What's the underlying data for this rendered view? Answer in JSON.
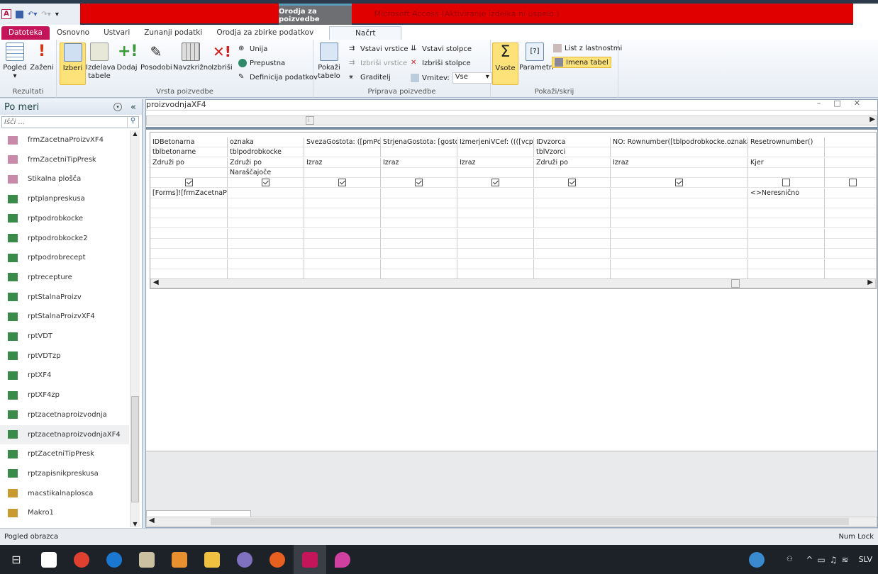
{
  "app": {
    "title": "Microsoft Access (Aktiviranje izdelka ni uspelo.)",
    "context_tab": "Orodja za poizvedbe",
    "accent": "#c4145a"
  },
  "tabs": [
    "Datoteka",
    "Osnovno",
    "Ustvari",
    "Zunanji podatki",
    "Orodja za zbirke podatkov",
    "Načrt"
  ],
  "ribbon": {
    "rezultati": {
      "label": "Rezultati",
      "pogled": "Pogled",
      "zazeni": "Zaženi"
    },
    "vrsta": {
      "label": "Vrsta poizvedbe",
      "izberi": "Izberi",
      "izdelava": "Izdelava tabele",
      "dodaj": "Dodaj",
      "posodobi": "Posodobi",
      "navzkrizno": "Navzkrižno",
      "izbrisi": "Izbriši",
      "unija": "Unija",
      "prepustna": "Prepustna",
      "definicija": "Definicija podatkov"
    },
    "priprava": {
      "label": "Priprava poizvedbe",
      "pokazi": "Pokaži tabelo",
      "vstavi_vrstice": "Vstavi vrstice",
      "izbrisi_vrstice": "Izbriši vrstice",
      "graditelj": "Graditelj",
      "vstavi_stolpce": "Vstavi stolpce",
      "izbrisi_stolpce": "Izbriši stolpce",
      "vrnitev": "Vrnitev:",
      "vrnitev_value": "Vse"
    },
    "pokazi_skrij": {
      "label": "Pokaži/skrij",
      "vsote": "Vsote",
      "parametri": "Parametri",
      "list": "List z lastnostmi",
      "imena": "Imena tabel"
    }
  },
  "nav": {
    "title": "Po meri",
    "search_placeholder": "Išči ...",
    "items": [
      {
        "label": "frmZacetnaProizvXF4",
        "type": "form"
      },
      {
        "label": "frmZacetniTipPresk",
        "type": "form"
      },
      {
        "label": "Stikalna plošča",
        "type": "form"
      },
      {
        "label": "rptplanpreskusa",
        "type": "report"
      },
      {
        "label": "rptpodrobkocke",
        "type": "report"
      },
      {
        "label": "rptpodrobkocke2",
        "type": "report"
      },
      {
        "label": "rptpodrobrecept",
        "type": "report"
      },
      {
        "label": "rptrecepture",
        "type": "report"
      },
      {
        "label": "rptStalnaProizv",
        "type": "report"
      },
      {
        "label": "rptStalnaProizvXF4",
        "type": "report"
      },
      {
        "label": "rptVDT",
        "type": "report"
      },
      {
        "label": "rptVDTzp",
        "type": "report"
      },
      {
        "label": "rptXF4",
        "type": "report"
      },
      {
        "label": "rptXF4zp",
        "type": "report"
      },
      {
        "label": "rptzacetnaproizvodnja",
        "type": "report"
      },
      {
        "label": "rptzacetnaproizvodnjaXF4",
        "type": "report",
        "selected": true
      },
      {
        "label": "rptZacetniTipPresk",
        "type": "report"
      },
      {
        "label": "rptzapisnikpreskusa",
        "type": "report"
      },
      {
        "label": "macstikalnaplosca",
        "type": "macro"
      },
      {
        "label": "Makro1",
        "type": "macro"
      }
    ]
  },
  "query": {
    "title": "proizvodnjaXF4",
    "columns": [
      {
        "field": "IDBetonarna",
        "table": "tblbetonarne",
        "total": "Združi po",
        "sort": "",
        "show": true,
        "criteria": "[Forms]![frmZacetnaProi"
      },
      {
        "field": "oznaka",
        "table": "tblpodrobkocke",
        "total": "Združi po",
        "sort": "Naraščajoče",
        "show": true,
        "criteria": ""
      },
      {
        "field": "SvezaGostota: ([pmPoln",
        "table": "",
        "total": "Izraz",
        "sort": "",
        "show": true,
        "criteria": ""
      },
      {
        "field": "StrjenaGostota: [gostota",
        "table": "",
        "total": "Izraz",
        "sort": "",
        "show": true,
        "criteria": ""
      },
      {
        "field": "IzmerjeniVCef: ((([vcpoln",
        "table": "",
        "total": "Izraz",
        "sort": "",
        "show": true,
        "criteria": ""
      },
      {
        "field": "IDvzorca",
        "table": "tblVzorci",
        "total": "Združi po",
        "sort": "",
        "show": true,
        "criteria": ""
      },
      {
        "field": "NO: Rownumber([tblpodrobkocke.oznaka])",
        "table": "",
        "total": "Izraz",
        "sort": "",
        "show": true,
        "criteria": ""
      },
      {
        "field": "Resetrownumber()",
        "table": "",
        "total": "Kjer",
        "sort": "",
        "show": false,
        "criteria": "<>Neresnično"
      },
      {
        "field": "",
        "table": "",
        "total": "",
        "sort": "",
        "show": false,
        "criteria": ""
      }
    ]
  },
  "status": {
    "left": "Pogled obrazca",
    "right": "Num Lock"
  },
  "taskbar": {
    "lang": "SLV"
  }
}
